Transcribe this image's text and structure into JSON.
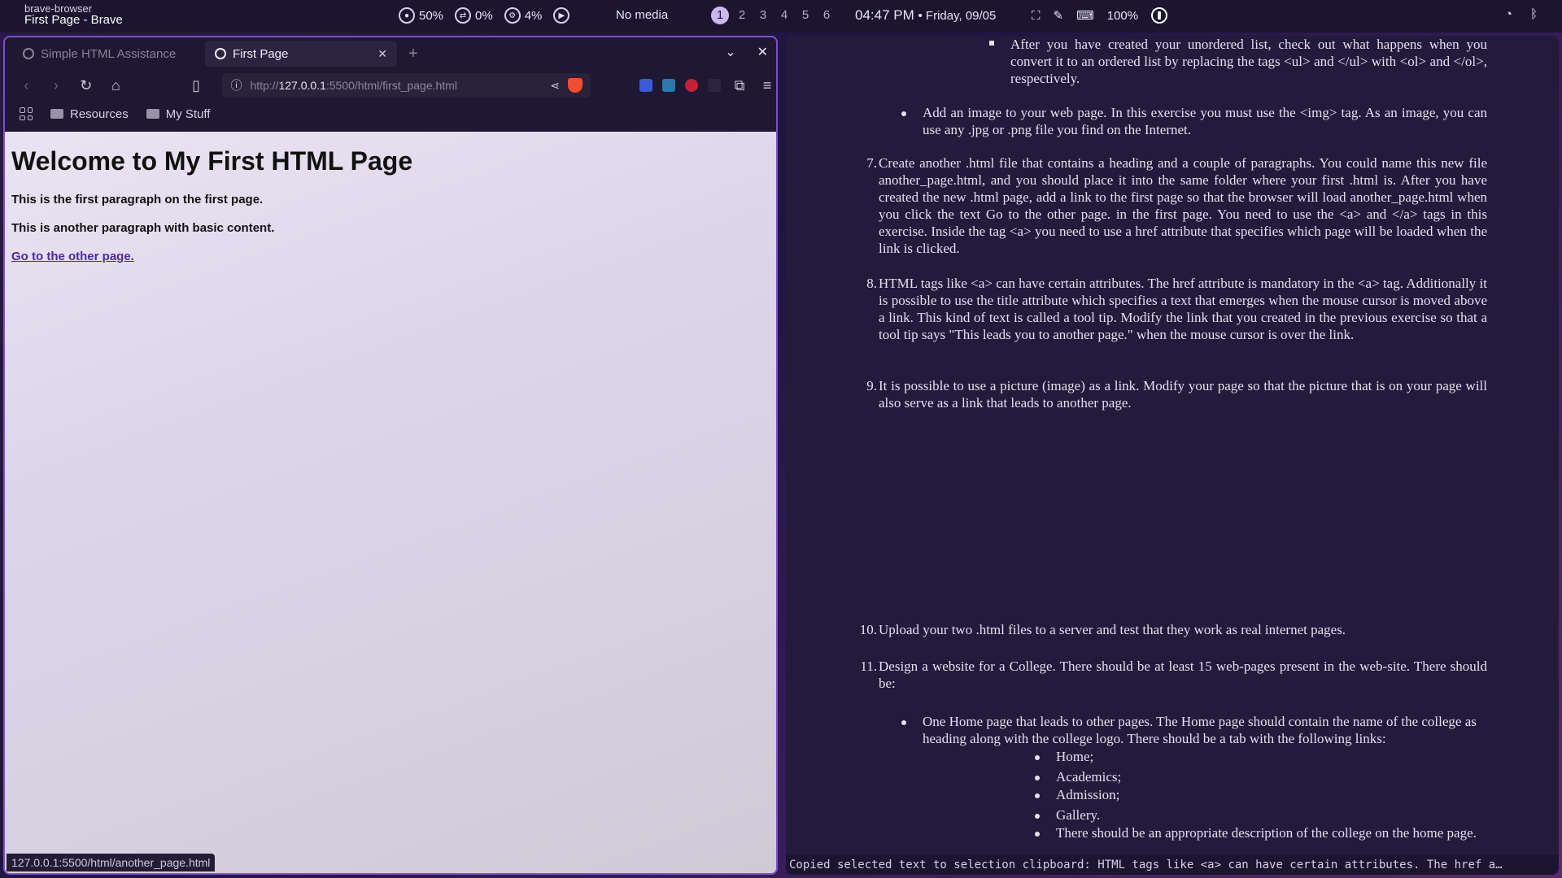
{
  "topbar": {
    "app_name": "brave-browser",
    "window_title": "First Page - Brave",
    "cpu": "50%",
    "swap": "0%",
    "temp": "4%",
    "media": "No media",
    "workspaces": [
      "1",
      "2",
      "3",
      "4",
      "5",
      "6"
    ],
    "active_workspace": "1",
    "time": "04:47 PM",
    "date": "• Friday, 09/05",
    "brightness": "100%"
  },
  "browser": {
    "tabs": [
      {
        "label": "Simple HTML Assistance",
        "active": false
      },
      {
        "label": "First Page",
        "active": true
      }
    ],
    "url_scheme": "http://",
    "url_host": "127.0.0.1",
    "url_path": ":5500/html/first_page.html",
    "bookmarks": [
      "Resources",
      "My Stuff"
    ],
    "page": {
      "heading": "Welcome to My First HTML Page",
      "p1": "This is the first paragraph on the first page.",
      "p2": "This is another paragraph with basic content.",
      "link": "Go to the other page."
    },
    "status_url": "127.0.0.1:5500/html/another_page.html"
  },
  "doc": {
    "item_ul_ol": "After you have created your unordered list, check out what happens when you convert it to an ordered list by replacing the tags <ul> and </ul> with <ol> and </ol>, respectively.",
    "item_image": "Add an image to your web page. In this exercise you must use the <img> tag. As an image, you can use any .jpg or .png file you find on the Internet.",
    "items": [
      {
        "num": "7.",
        "text": "Create another .html file that contains a heading and a couple of paragraphs. You could name this new file another_page.html, and you should place it into the same folder where your first .html is. After you have created the new .html page, add a link to the first page so that the browser will load another_page.html when you click the text Go to the other page. in the first page. You need to use the <a> and </a> tags in this exercise. Inside the tag <a> you need to use a href attribute that specifies which page will be loaded when the link is clicked."
      },
      {
        "num": "8.",
        "text": "HTML tags like <a> can have certain attributes. The href attribute is mandatory in the <a> tag. Additionally it is possible to use the title attribute which specifies a text that emerges when the mouse cursor is moved above a link. This kind of text is called a tool tip. Modify the link that you created in the previous exercise so that a tool tip says \"This leads you to another page.\" when the mouse cursor is over the link."
      },
      {
        "num": "9.",
        "text": "It is possible to use a picture (image) as a link. Modify your page so that the picture that is on your page will also serve as a link that leads to another page."
      },
      {
        "num": "10.",
        "text": "Upload your two .html files to a server and test that they work as real internet pages."
      },
      {
        "num": "11.",
        "text": "Design a website for a College. There should be at least 15 web-pages present in the web-site. There should be:"
      }
    ],
    "item_home": "One Home page that leads to other pages. The Home page should contain the name of the college as heading along with the college logo. There should be a tab with the following links:",
    "sub_items": [
      "Home;",
      "Academics;",
      "Admission;",
      "Gallery.",
      "There should be an appropriate description of the college on the home page."
    ],
    "clipboard": "Copied selected text to selection clipboard: HTML tags like <a> can have certain attributes. The href a…"
  }
}
